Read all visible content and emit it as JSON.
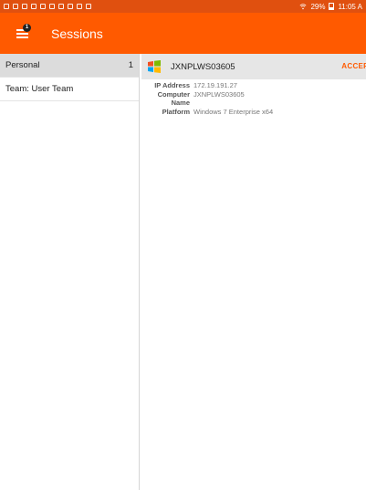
{
  "status_bar": {
    "battery": "29%",
    "time": "11:05 A"
  },
  "app_bar": {
    "title": "Sessions",
    "menu_badge": "1",
    "color": "#ff5a00"
  },
  "sidebar": {
    "items": [
      {
        "label": "Personal",
        "count": "1",
        "selected": true
      },
      {
        "label": "Team: User Team",
        "count": "",
        "selected": false
      }
    ]
  },
  "session": {
    "name": "JXNPLWS03605",
    "action_label": "ACCEPT",
    "icon": "windows-icon",
    "details": [
      {
        "label": "IP Address",
        "value": "172.19.191.27"
      },
      {
        "label": "Computer Name",
        "value": "JXNPLWS03605"
      },
      {
        "label": "Platform",
        "value": "Windows 7 Enterprise x64"
      }
    ]
  }
}
